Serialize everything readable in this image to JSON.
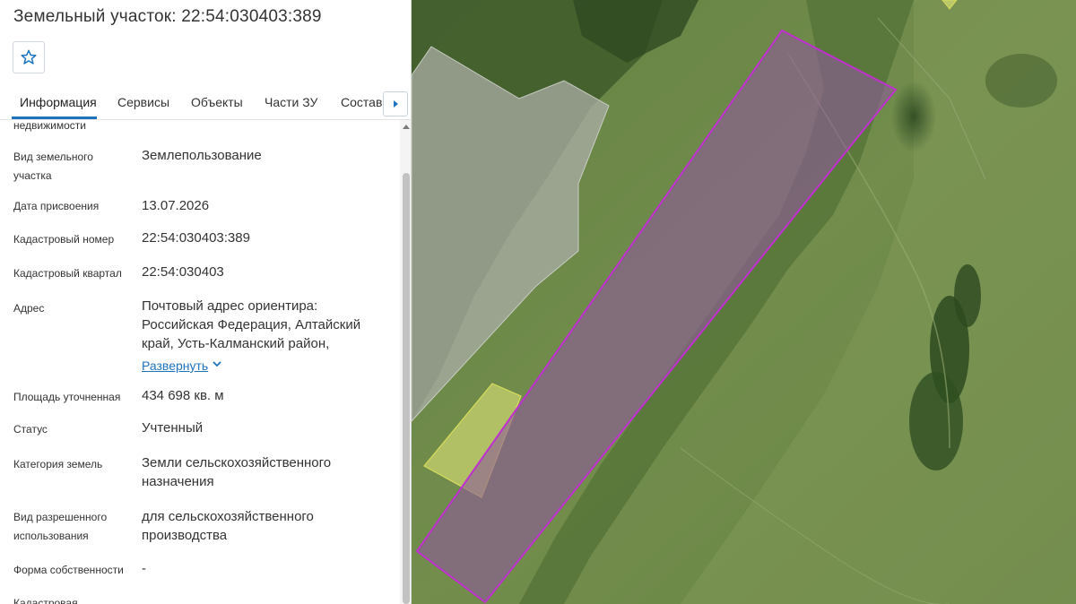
{
  "header": {
    "title": "Земельный участок: 22:54:030403:389"
  },
  "favorite": {
    "icon": "star-icon"
  },
  "tabs": [
    {
      "label": "Информация",
      "active": true
    },
    {
      "label": "Сервисы",
      "active": false
    },
    {
      "label": "Объекты",
      "active": false
    },
    {
      "label": "Части ЗУ",
      "active": false
    },
    {
      "label": "Состав",
      "active": false
    }
  ],
  "tabs_next_icon": "chevron-right-icon",
  "details": {
    "cut_top_label": "недвижимости",
    "land_type": {
      "label": "Вид земельного участка",
      "value": "Землепользование"
    },
    "assign_date": {
      "label": "Дата присвоения",
      "value": "13.07.2026"
    },
    "cadastral_number": {
      "label": "Кадастровый номер",
      "value": "22:54:030403:389"
    },
    "cadastral_block": {
      "label": "Кадастровый квартал",
      "value": "22:54:030403"
    },
    "address": {
      "label": "Адрес",
      "value": "Почтовый адрес ориентира: Российская Федерация, Алтайский край, Усть-Калманский район,",
      "expand_label": "Развернуть"
    },
    "area": {
      "label": "Площадь уточненная",
      "value": "434 698 кв. м"
    },
    "status": {
      "label": "Статус",
      "value": "Учтенный"
    },
    "land_category": {
      "label": "Категория земель",
      "value": "Земли сельскохозяйственного назначения"
    },
    "permitted_use": {
      "label": "Вид разрешенного использования",
      "value": "для сельскохозяйственного производства"
    },
    "ownership": {
      "label": "Форма собственности",
      "value": "-"
    },
    "cut_bottom_label": "Кадастровая"
  },
  "colors": {
    "accent": "#1e73be",
    "parcel_fill": "#8e5a9a",
    "parcel_stroke": "#c02fd0",
    "neighbor_fill": "#e8ec7a",
    "gray_area": "#a9ada6"
  }
}
